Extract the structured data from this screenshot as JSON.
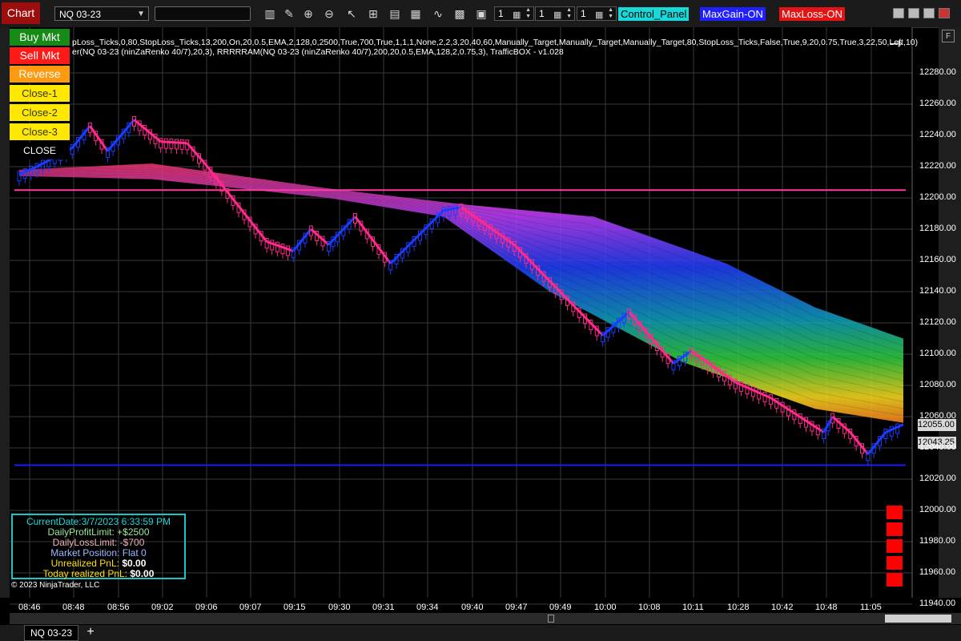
{
  "toolbar": {
    "chart_tab": "Chart",
    "instrument": "NQ 03-23",
    "search_value": "",
    "spinners": [
      "1",
      "1",
      "1"
    ],
    "badges": [
      {
        "label": "Control_Panel",
        "bg": "#18d8d8",
        "fg": "#000000"
      },
      {
        "label": "MaxGain-ON",
        "bg": "#1f1fff",
        "fg": "#ffffff"
      },
      {
        "label": "MaxLoss-ON",
        "bg": "#e51414",
        "fg": "#ffffff"
      }
    ],
    "icons": [
      "bar-chart-icon",
      "pencil-icon",
      "zoom-in-icon",
      "zoom-out-icon",
      "cursor-icon",
      "add-window-icon",
      "properties-icon",
      "strategies-icon",
      "indicators-icon",
      "grid-icon",
      "templates-icon"
    ]
  },
  "panel": {
    "buy": "Buy Mkt",
    "sell": "Sell Mkt",
    "reverse": "Reverse",
    "close1": "Close-1",
    "close2": "Close-2",
    "close3": "Close-3",
    "close": "CLOSE"
  },
  "indicators": {
    "line1": "pLoss_Ticks,0,80,StopLoss_Ticks,13,200,On,20,0.5,EMA,2,128,0,2500,True,700,True,1,1,1,None,2,2,3,20,40,60,Manually_Target,Manually_Target,Manually_Target,80,StopLoss_Ticks,False,True,9,20,0.75,True,3,22,50,Left,10)",
    "line2": "er(NQ 03-23 (ninZaRenko 40/7),20,3), RRRRRAM(NQ 03-23 (ninZaRenko 40/7),200,20,0.5,EMA,128,2,0.75,3), TrafficBOX - v1.028"
  },
  "info": {
    "current_date": "CurrentDate:3/7/2023 6:33:59 PM",
    "daily_profit_label": "DailyProfitLimit:",
    "daily_profit_value": "+$2500",
    "daily_loss_label": "DailyLossLimit:",
    "daily_loss_value": "-$700",
    "position_label": "Market Position:",
    "position_value": "Flat 0",
    "unrealized_label": "Unrealized PnL:",
    "unrealized_value": "$0.00",
    "realized_label": "Today realized PnL:",
    "realized_value": "$0.00"
  },
  "copyright": "© 2023 NinjaTrader, LLC",
  "bottom_tab": "NQ 03-23",
  "add_tab": "+",
  "chart_data": {
    "type": "candlestick-renko",
    "instrument": "NQ 03-23",
    "price_ticks": [
      "12280.00",
      "12260.00",
      "12240.00",
      "12220.00",
      "12200.00",
      "12180.00",
      "12160.00",
      "12140.00",
      "12120.00",
      "12100.00",
      "12080.00",
      "12060.00",
      "12040.00",
      "12020.00",
      "12000.00",
      "11980.00",
      "11960.00",
      "11940.00"
    ],
    "time_ticks": [
      "08:46",
      "08:48",
      "08:56",
      "09:02",
      "09:06",
      "09:07",
      "09:15",
      "09:30",
      "09:31",
      "09:34",
      "09:40",
      "09:47",
      "09:49",
      "10:00",
      "10:08",
      "10:11",
      "10:28",
      "10:42",
      "10:48",
      "11:05"
    ],
    "ylim": [
      11934,
      12293
    ],
    "price_flags": [
      "12055.00",
      "12043.25"
    ],
    "horizontal_lines": [
      {
        "price": 12205,
        "color": "#ff3aa0"
      },
      {
        "price": 12029,
        "color": "#1a1aff"
      }
    ],
    "price_path": [
      {
        "x": 0,
        "y": 12215
      },
      {
        "x": 2,
        "y": 12220
      },
      {
        "x": 6,
        "y": 12232
      },
      {
        "x": 8,
        "y": 12246
      },
      {
        "x": 10,
        "y": 12230
      },
      {
        "x": 13,
        "y": 12250
      },
      {
        "x": 16,
        "y": 12236
      },
      {
        "x": 19,
        "y": 12235
      },
      {
        "x": 21,
        "y": 12222
      },
      {
        "x": 28,
        "y": 12172
      },
      {
        "x": 31,
        "y": 12166
      },
      {
        "x": 33,
        "y": 12180
      },
      {
        "x": 35,
        "y": 12170
      },
      {
        "x": 36,
        "y": 12176
      },
      {
        "x": 38,
        "y": 12188
      },
      {
        "x": 42,
        "y": 12158
      },
      {
        "x": 48,
        "y": 12192
      },
      {
        "x": 50,
        "y": 12194
      },
      {
        "x": 56,
        "y": 12170
      },
      {
        "x": 66,
        "y": 12112
      },
      {
        "x": 69,
        "y": 12127
      },
      {
        "x": 74,
        "y": 12094
      },
      {
        "x": 76,
        "y": 12102
      },
      {
        "x": 81,
        "y": 12082
      },
      {
        "x": 85,
        "y": 12072
      },
      {
        "x": 91,
        "y": 12050
      },
      {
        "x": 92,
        "y": 12060
      },
      {
        "x": 94,
        "y": 12050
      },
      {
        "x": 96,
        "y": 12036
      },
      {
        "x": 98,
        "y": 12050
      },
      {
        "x": 100,
        "y": 12055
      }
    ],
    "ribbon": {
      "top": [
        {
          "x": 0,
          "y": 12218
        },
        {
          "x": 15,
          "y": 12222
        },
        {
          "x": 35,
          "y": 12206
        },
        {
          "x": 50,
          "y": 12196
        },
        {
          "x": 65,
          "y": 12188
        },
        {
          "x": 80,
          "y": 12158
        },
        {
          "x": 90,
          "y": 12130
        },
        {
          "x": 100,
          "y": 12110
        }
      ],
      "bottom": [
        {
          "x": 0,
          "y": 12214
        },
        {
          "x": 15,
          "y": 12212
        },
        {
          "x": 35,
          "y": 12200
        },
        {
          "x": 48,
          "y": 12188
        },
        {
          "x": 60,
          "y": 12140
        },
        {
          "x": 75,
          "y": 12095
        },
        {
          "x": 90,
          "y": 12065
        },
        {
          "x": 100,
          "y": 12056
        }
      ]
    },
    "up_color": "#1a3cff",
    "down_color": "#ff2a8a"
  },
  "alert_blocks": 5
}
